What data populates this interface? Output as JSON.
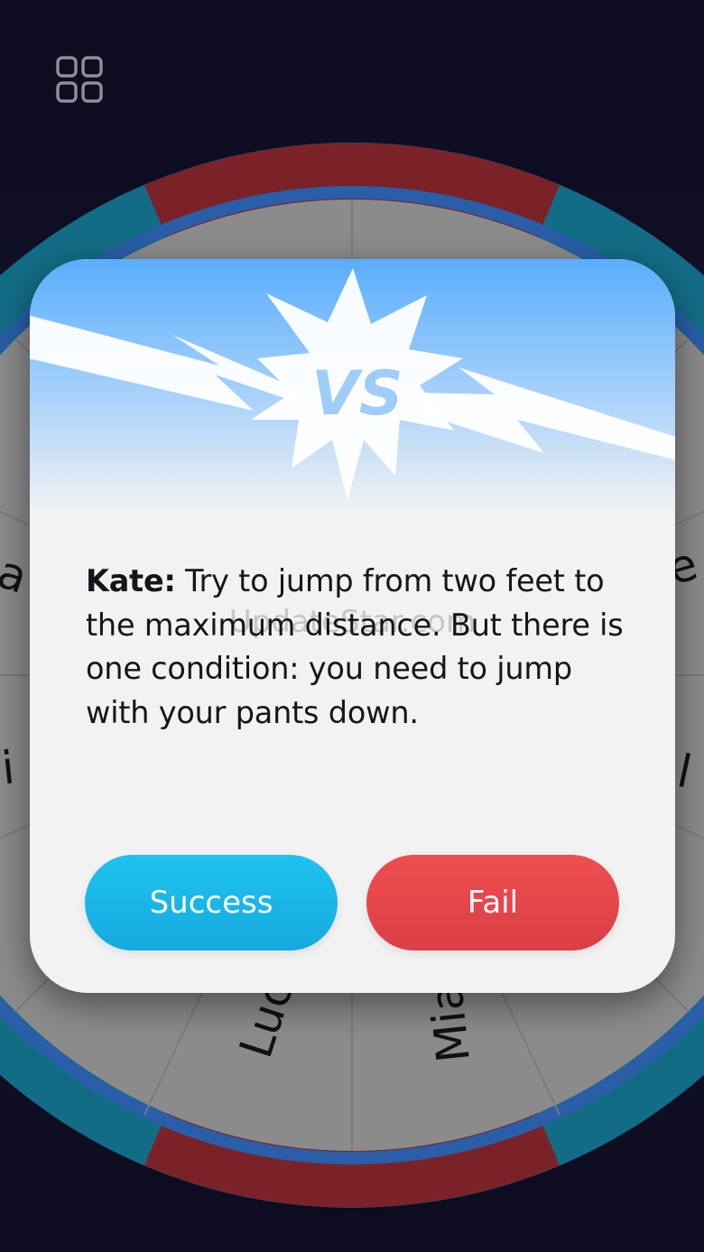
{
  "app": {
    "menu_icon": "grid-menu-icon"
  },
  "wheel": {
    "segments_visible": [
      "Mia",
      "Lucy"
    ],
    "colors": {
      "rim_teal": "#136c86",
      "rim_red": "#7d2428",
      "face": "#8c8c8c"
    }
  },
  "modal": {
    "header_icon": "vs-burst-icon",
    "player": "Kate:",
    "task": "Try to jump from two feet to the maximum distance. But there is one condition: you need to jump with your pants down.",
    "watermark": "UpdateStar.com",
    "buttons": {
      "success": "Success",
      "fail": "Fail"
    },
    "colors": {
      "success": "#1bb8e8",
      "fail": "#e5474b",
      "header_sky": "#5aaefc"
    }
  }
}
